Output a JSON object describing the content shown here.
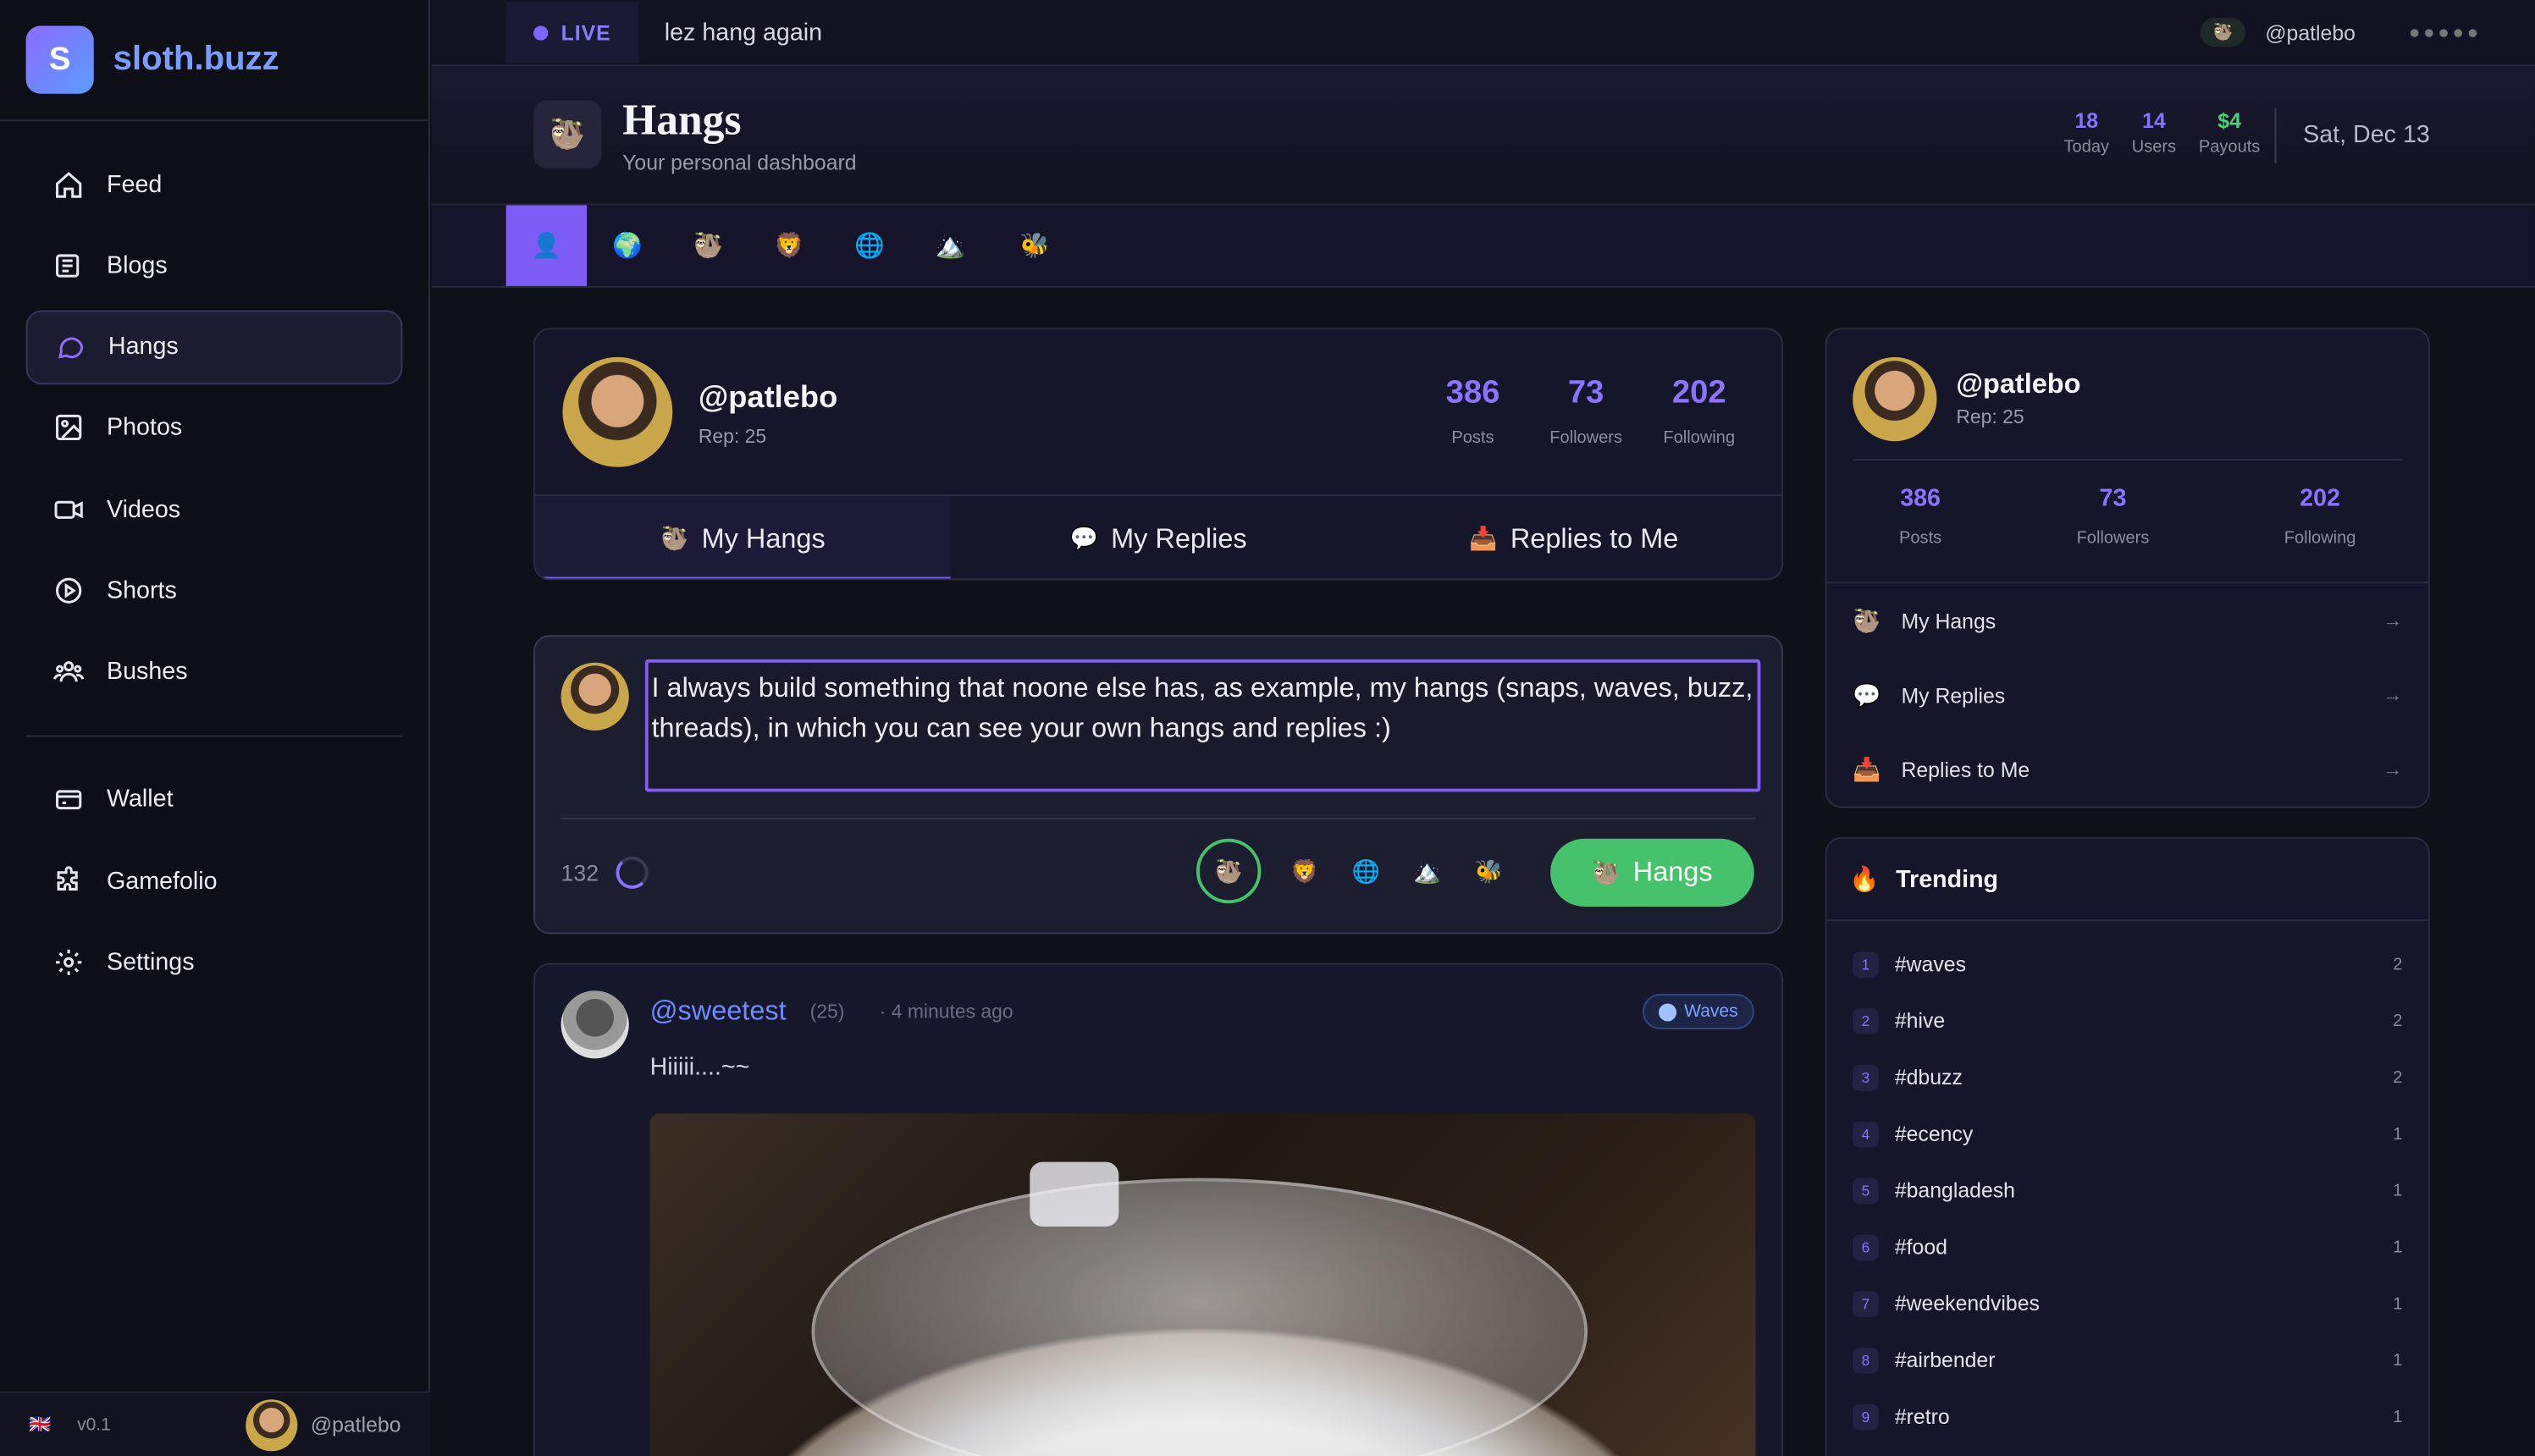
{
  "brand": {
    "logo_letter": "S",
    "name": "sloth.buzz"
  },
  "nav": {
    "items": [
      {
        "label": "Feed",
        "icon": "home-icon"
      },
      {
        "label": "Blogs",
        "icon": "blog-icon"
      },
      {
        "label": "Hangs",
        "icon": "chat-bubble-icon",
        "active": true
      },
      {
        "label": "Photos",
        "icon": "image-icon"
      },
      {
        "label": "Videos",
        "icon": "video-icon"
      },
      {
        "label": "Shorts",
        "icon": "play-circle-icon"
      },
      {
        "label": "Bushes",
        "icon": "group-icon"
      }
    ],
    "secondary": [
      {
        "label": "Wallet",
        "icon": "wallet-icon"
      },
      {
        "label": "Gamefolio",
        "icon": "puzzle-icon"
      },
      {
        "label": "Settings",
        "icon": "gear-icon"
      }
    ]
  },
  "footer": {
    "flag": "🇬🇧",
    "version": "v0.1",
    "username": "@patlebo"
  },
  "topbar": {
    "live_label": "LIVE",
    "ticker": "lez hang again",
    "username": "@patlebo"
  },
  "header": {
    "icon": "🦥",
    "title": "Hangs",
    "subtitle": "Your personal dashboard",
    "stats": [
      {
        "value": "18",
        "label": "Today"
      },
      {
        "value": "14",
        "label": "Users"
      },
      {
        "value": "$4",
        "label": "Payouts"
      }
    ],
    "date": "Sat, Dec 13"
  },
  "strip": {
    "tabs": [
      "👤",
      "🌍",
      "🦥",
      "🦁",
      "🌐",
      "🏔️",
      "🐝"
    ]
  },
  "profile": {
    "username": "@patlebo",
    "rep": "Rep: 25",
    "stats": [
      {
        "value": "386",
        "label": "Posts"
      },
      {
        "value": "73",
        "label": "Followers"
      },
      {
        "value": "202",
        "label": "Following"
      }
    ],
    "tabs": [
      {
        "emoji": "🦥",
        "label": "My Hangs",
        "active": true
      },
      {
        "emoji": "💬",
        "label": "My Replies"
      },
      {
        "emoji": "📥",
        "label": "Replies to Me"
      }
    ]
  },
  "compose": {
    "text": "I always build something that noone else has, as example, my hangs (snaps, waves, buzz, threads), in which you can see your own hangs and replies :)",
    "remaining": "132",
    "picks": [
      "🦥",
      "🦁",
      "🌐",
      "🏔️",
      "🐝"
    ],
    "button_emoji": "🦥",
    "button_label": "Hangs"
  },
  "post": {
    "username": "@sweetest",
    "rep": "(25)",
    "time": "· 4 minutes ago",
    "badge": "Waves",
    "text": "Hiiiii....~~"
  },
  "right_profile": {
    "username": "@patlebo",
    "rep": "Rep: 25",
    "stats": [
      {
        "value": "386",
        "label": "Posts"
      },
      {
        "value": "73",
        "label": "Followers"
      },
      {
        "value": "202",
        "label": "Following"
      }
    ],
    "links": [
      {
        "emoji": "🦥",
        "label": "My Hangs",
        "arrow": "→"
      },
      {
        "emoji": "💬",
        "label": "My Replies",
        "arrow": "→"
      },
      {
        "emoji": "📥",
        "label": "Replies to Me",
        "arrow": "→"
      }
    ]
  },
  "trending": {
    "emoji": "🔥",
    "title": "Trending",
    "items": [
      {
        "rank": "1",
        "tag": "#waves",
        "count": "2"
      },
      {
        "rank": "2",
        "tag": "#hive",
        "count": "2"
      },
      {
        "rank": "3",
        "tag": "#dbuzz",
        "count": "2"
      },
      {
        "rank": "4",
        "tag": "#ecency",
        "count": "1"
      },
      {
        "rank": "5",
        "tag": "#bangladesh",
        "count": "1"
      },
      {
        "rank": "6",
        "tag": "#food",
        "count": "1"
      },
      {
        "rank": "7",
        "tag": "#weekendvibes",
        "count": "1"
      },
      {
        "rank": "8",
        "tag": "#airbender",
        "count": "1"
      },
      {
        "rank": "9",
        "tag": "#retro",
        "count": "1"
      }
    ]
  },
  "colors": {
    "accent": "#7c5cf5",
    "green": "#46c16c",
    "link": "#6d8cff"
  }
}
